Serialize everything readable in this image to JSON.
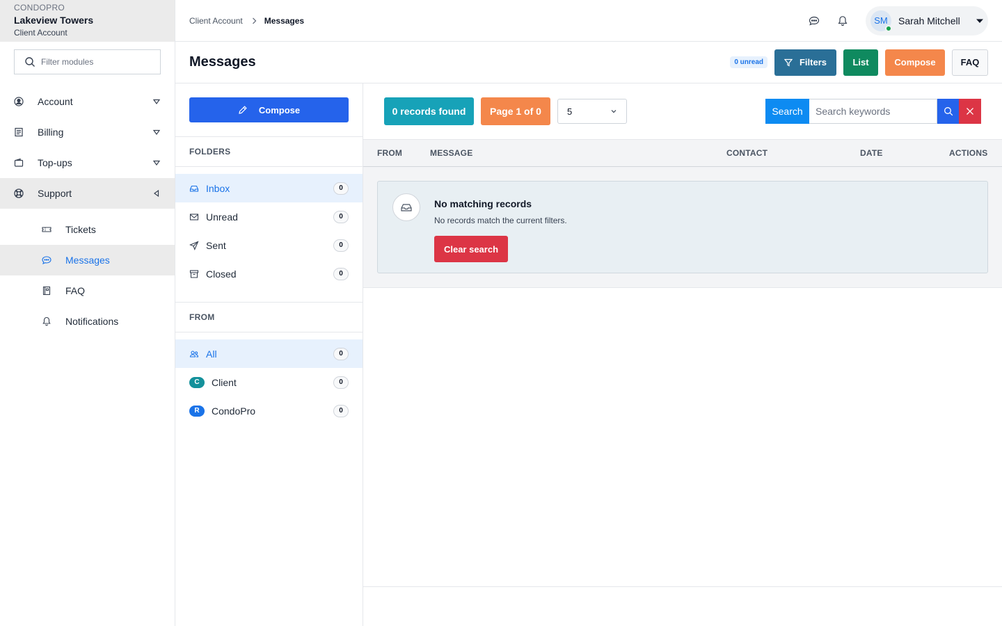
{
  "org": {
    "brand": "CONDOPRO",
    "name": "Lakeview Towers",
    "account_type": "Client Account"
  },
  "sidebar": {
    "filter_placeholder": "Filter modules",
    "items": [
      {
        "label": "Account",
        "icon": "user-circle-icon"
      },
      {
        "label": "Billing",
        "icon": "receipt-icon"
      },
      {
        "label": "Top-ups",
        "icon": "wallet-icon"
      },
      {
        "label": "Support",
        "icon": "lifebuoy-icon"
      }
    ],
    "support_items": [
      {
        "label": "Tickets",
        "icon": "ticket-icon"
      },
      {
        "label": "Messages",
        "icon": "chat-icon"
      },
      {
        "label": "FAQ",
        "icon": "book-icon"
      },
      {
        "label": "Notifications",
        "icon": "bell-icon"
      }
    ]
  },
  "topbar": {
    "breadcrumb": [
      "Client Account",
      "Messages"
    ],
    "user": {
      "initials": "SM",
      "name": "Sarah Mitchell"
    }
  },
  "page": {
    "title": "Messages",
    "unread_badge": "0 unread",
    "actions": {
      "filters": "Filters",
      "list": "List",
      "compose": "Compose",
      "faq": "FAQ"
    }
  },
  "folders": {
    "compose_label": "Compose",
    "folders_heading": "FOLDERS",
    "items": [
      {
        "label": "Inbox",
        "count": "0",
        "icon": "inbox-icon"
      },
      {
        "label": "Unread",
        "count": "0",
        "icon": "envelope-icon"
      },
      {
        "label": "Sent",
        "count": "0",
        "icon": "send-icon"
      },
      {
        "label": "Closed",
        "count": "0",
        "icon": "archive-icon"
      }
    ],
    "from_heading": "FROM",
    "from_items": [
      {
        "label": "All",
        "count": "0",
        "icon": "users-icon"
      },
      {
        "label": "Client",
        "count": "0",
        "badge": "C"
      },
      {
        "label": "CondoPro",
        "count": "0",
        "badge": "R"
      }
    ]
  },
  "main": {
    "records_found": "0 records found",
    "page_info": "Page 1 of 0",
    "per_page": "5",
    "search": {
      "label": "Search",
      "placeholder": "Search keywords"
    },
    "columns": [
      "FROM",
      "MESSAGE",
      "CONTACT",
      "DATE",
      "ACTIONS"
    ],
    "empty": {
      "title": "No matching records",
      "subtitle": "No records match the current filters.",
      "clear_label": "Clear search"
    }
  },
  "colors": {
    "accent": "#1a73e8",
    "filters": "#2a6f97",
    "list": "#0f8a5f",
    "compose": "#f4874b",
    "records": "#17a2b8",
    "danger": "#dc3545"
  }
}
